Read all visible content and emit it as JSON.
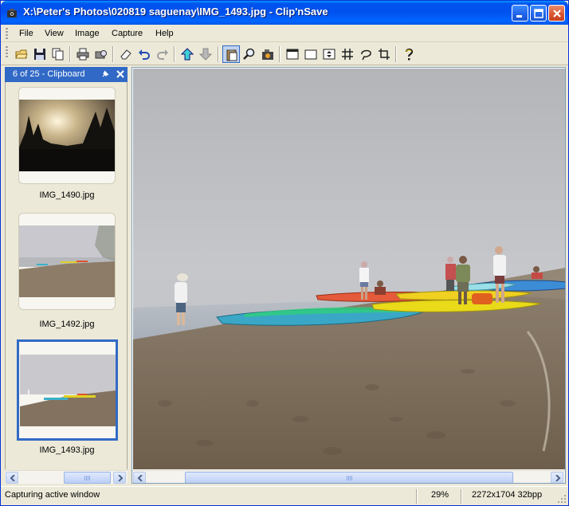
{
  "window": {
    "title": "X:\\Peter's Photos\\020819 saguenay\\IMG_1493.jpg - Clip'nSave",
    "app_icon": "camera-app-icon",
    "controls": [
      "minimize-icon",
      "maximize-icon",
      "close-icon"
    ]
  },
  "menu": {
    "items": [
      "File",
      "View",
      "Image",
      "Capture",
      "Help"
    ]
  },
  "toolbar": {
    "buttons": [
      "open-folder-icon",
      "save-icon",
      "copy-icon",
      "print-icon",
      "print-preview-icon",
      "eraser-icon",
      "undo-icon",
      "redo-icon",
      "arrow-up-icon",
      "arrow-down-icon",
      "clipboard-icon",
      "zoom-icon",
      "capture-screen-icon",
      "capture-window-icon",
      "capture-rectangle-icon",
      "capture-scrolling-icon",
      "capture-grid-icon",
      "capture-freehand-icon",
      "crop-icon",
      "help-icon"
    ],
    "pressed": "clipboard-icon"
  },
  "panel": {
    "title": "6 of 25 - Clipboard",
    "pin_icon": "pin-icon",
    "close_icon": "close-icon",
    "thumbnails": [
      {
        "label": "IMG_1490.jpg",
        "selected": false
      },
      {
        "label": "IMG_1492.jpg",
        "selected": false
      },
      {
        "label": "IMG_1493.jpg",
        "selected": true
      }
    ]
  },
  "status": {
    "message": "Capturing active window",
    "zoom": "29%",
    "image_info": "2272x1704 32bpp"
  },
  "colors": {
    "titlebar": "#0055e5",
    "panel_header": "#3169c6",
    "selection": "#316ac5",
    "face": "#ece9d8"
  }
}
